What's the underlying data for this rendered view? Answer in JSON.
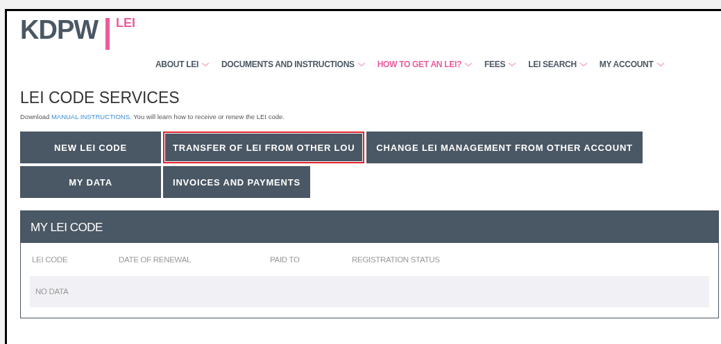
{
  "logo": {
    "brand": "KDPW",
    "product": "LEI"
  },
  "nav": [
    {
      "label": "ABOUT LEI",
      "selected": false
    },
    {
      "label": "DOCUMENTS AND INSTRUCTIONS",
      "selected": false
    },
    {
      "label": "HOW TO GET AN LEI?",
      "selected": true
    },
    {
      "label": "FEES",
      "selected": false
    },
    {
      "label": "LEI SEARCH",
      "selected": false
    },
    {
      "label": "MY ACCOUNT",
      "selected": false
    }
  ],
  "page_title": "LEI CODE SERVICES",
  "intro": {
    "before": "Download ",
    "link": "MANUAL INSTRUCTIONS.",
    "after": " You will learn how to receive or renew the LEI code."
  },
  "service_rows": [
    [
      {
        "label": "NEW LEI CODE",
        "highlighted": false
      },
      {
        "label": "TRANSFER OF LEI FROM OTHER LOU",
        "highlighted": true
      },
      {
        "label": "CHANGE LEI MANAGEMENT FROM OTHER ACCOUNT",
        "highlighted": false
      }
    ],
    [
      {
        "label": "MY DATA",
        "highlighted": false
      },
      {
        "label": "INVOICES AND PAYMENTS",
        "highlighted": false
      }
    ]
  ],
  "panel": {
    "title": "MY LEI CODE",
    "columns": [
      "LEI CODE",
      "DATE OF RENEWAL",
      "PAID TO",
      "REGISTRATION STATUS"
    ],
    "empty_text": "NO DATA"
  }
}
